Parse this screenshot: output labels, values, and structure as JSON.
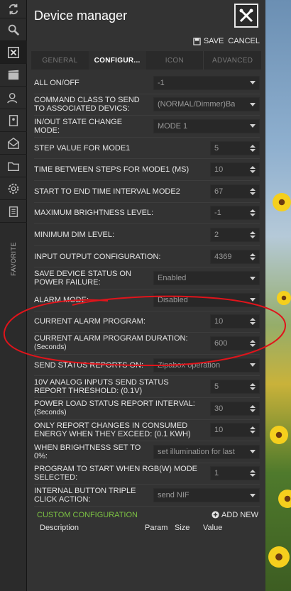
{
  "window": {
    "title": "Device manager"
  },
  "toolbar": {
    "save_label": "SAVE",
    "cancel_label": "CANCEL"
  },
  "tabs": [
    {
      "label": "GENERAL",
      "active": false
    },
    {
      "label": "CONFIGUR...",
      "active": true
    },
    {
      "label": "ICON",
      "active": false
    },
    {
      "label": "ADVANCED",
      "active": false
    }
  ],
  "rail": {
    "icons": [
      "sync-icon",
      "search-icon",
      "device-manager-icon",
      "movie-icon",
      "users-icon",
      "contacts-icon",
      "mail-icon",
      "folder-icon",
      "settings-icon",
      "clipboard-icon"
    ],
    "favorite_label": "FAVORITE"
  },
  "params": [
    {
      "label": "ALL ON/OFF",
      "value": "-1",
      "kind": "select"
    },
    {
      "label": "COMMAND CLASS TO SEND TO ASSOCIATED DEVICS:",
      "value": "(NORMAL/Dimmer)Ba",
      "kind": "select"
    },
    {
      "label": "IN/OUT STATE CHANGE MODE:",
      "value": "MODE 1",
      "kind": "select"
    },
    {
      "label": "STEP VALUE FOR MODE1",
      "value": "5",
      "kind": "number"
    },
    {
      "label": "TIME BETWEEN STEPS FOR MODE1 (ms)",
      "value": "10",
      "kind": "number"
    },
    {
      "label": "START TO END TIME INTERVAL MODE2",
      "value": "67",
      "kind": "number"
    },
    {
      "label": "MAXIMUM BRIGHTNESS LEVEL:",
      "value": "-1",
      "kind": "number"
    },
    {
      "label": "MINIMUM DIM LEVEL:",
      "value": "2",
      "kind": "number"
    },
    {
      "label": "INPUT OUTPUT CONFIGURATION:",
      "value": "4369",
      "kind": "number"
    },
    {
      "label": "SAVE DEVICE STATUS ON POWER FAILURE:",
      "value": "Enabled",
      "kind": "select"
    },
    {
      "label": "ALARM MODE:",
      "value": "Disabled",
      "kind": "select"
    },
    {
      "label": "CURRENT ALARM PROGRAM:",
      "value": "10",
      "kind": "number"
    },
    {
      "label": "CURRENT ALARM PROGRAM DURATION:",
      "sub": "(Seconds)",
      "value": "600",
      "kind": "number"
    },
    {
      "label": "SEND STATUS REPORTS ON:",
      "value": "Zipabox operation",
      "kind": "select"
    },
    {
      "label": "10V ANALOG INPUTS SEND STATUS REPORT THRESHOLD: (0.1V)",
      "value": "5",
      "kind": "number"
    },
    {
      "label": "POWER LOAD STATUS REPORT INTERVAL:",
      "sub": "(Seconds)",
      "value": "30",
      "kind": "number"
    },
    {
      "label": "ONLY REPORT CHANGES IN CONSUMED ENERGY WHEN THEY EXCEED: (0.1 kWh)",
      "value": "10",
      "kind": "number"
    },
    {
      "label": "WHEN BRIGHTNESS SET TO 0%:",
      "value": "set illumination for last",
      "kind": "select"
    },
    {
      "label": "PROGRAM TO START WHEN RGB(W) MODE SELECTED:",
      "value": "1",
      "kind": "number"
    },
    {
      "label": "INTERNAL BUTTON TRIPLE CLICK ACTION:",
      "value": "send NIF",
      "kind": "select"
    }
  ],
  "custom": {
    "title": "CUSTOM CONFIGURATION",
    "add_label": "ADD NEW",
    "columns": [
      "Description",
      "Param",
      "Size",
      "Value"
    ]
  },
  "colors": {
    "accent_green": "#7cc243",
    "annotation_red": "#e0141b"
  }
}
